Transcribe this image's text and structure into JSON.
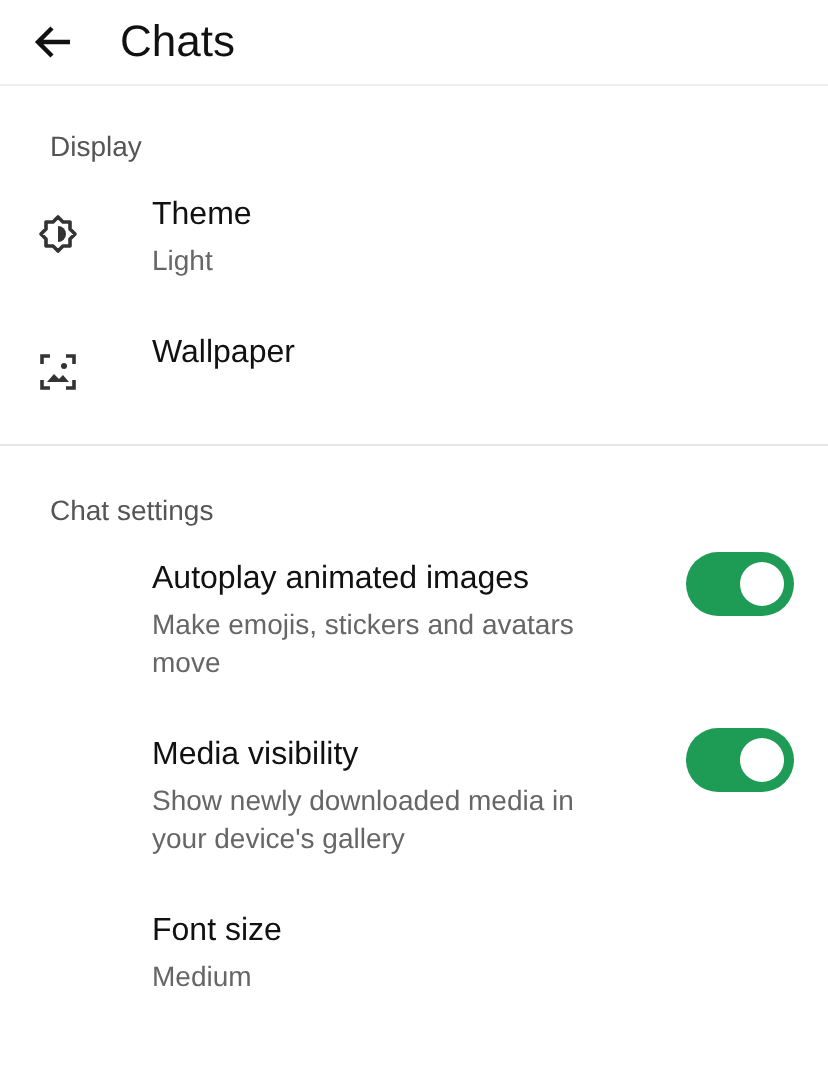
{
  "app_bar": {
    "title": "Chats"
  },
  "sections": [
    {
      "header": "Display",
      "items": [
        {
          "kind": "theme",
          "title": "Theme",
          "subtitle": "Light"
        },
        {
          "kind": "wallpaper",
          "title": "Wallpaper"
        }
      ]
    },
    {
      "header": "Chat settings",
      "items": [
        {
          "kind": "toggle",
          "title": "Autoplay animated images",
          "subtitle": "Make emojis, stickers and avatars move",
          "on": true
        },
        {
          "kind": "toggle",
          "title": "Media visibility",
          "subtitle": "Show newly downloaded media in your device's gallery",
          "on": true
        },
        {
          "kind": "plain",
          "title": "Font size",
          "subtitle": "Medium"
        }
      ]
    }
  ]
}
